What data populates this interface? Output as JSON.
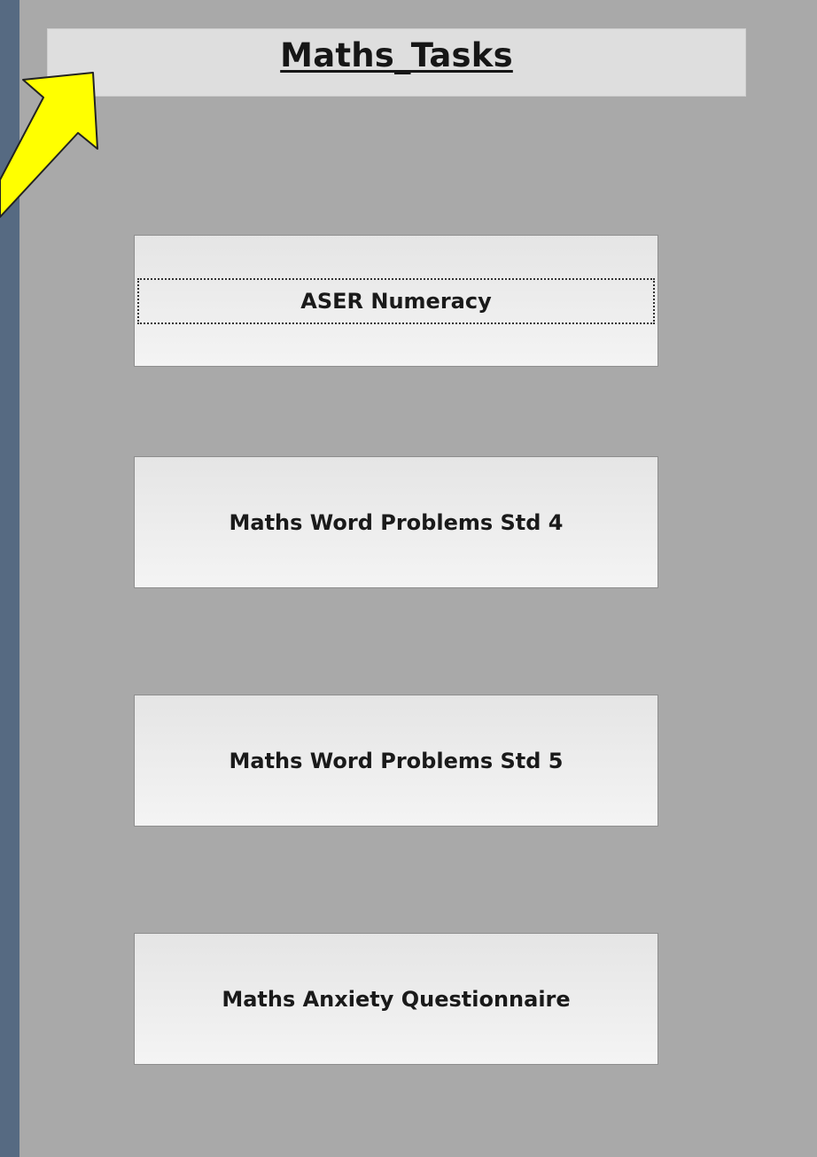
{
  "header": {
    "title": "Maths_Tasks"
  },
  "tasks": [
    {
      "label": "ASER Numeracy",
      "focused": true
    },
    {
      "label": "Maths Word Problems Std 4",
      "focused": false
    },
    {
      "label": "Maths Word Problems Std 5",
      "focused": false
    },
    {
      "label": "Maths Anxiety Questionnaire",
      "focused": false
    }
  ],
  "annotation": {
    "arrow_color": "#ffff00",
    "icon": "pointer-arrow-icon"
  }
}
